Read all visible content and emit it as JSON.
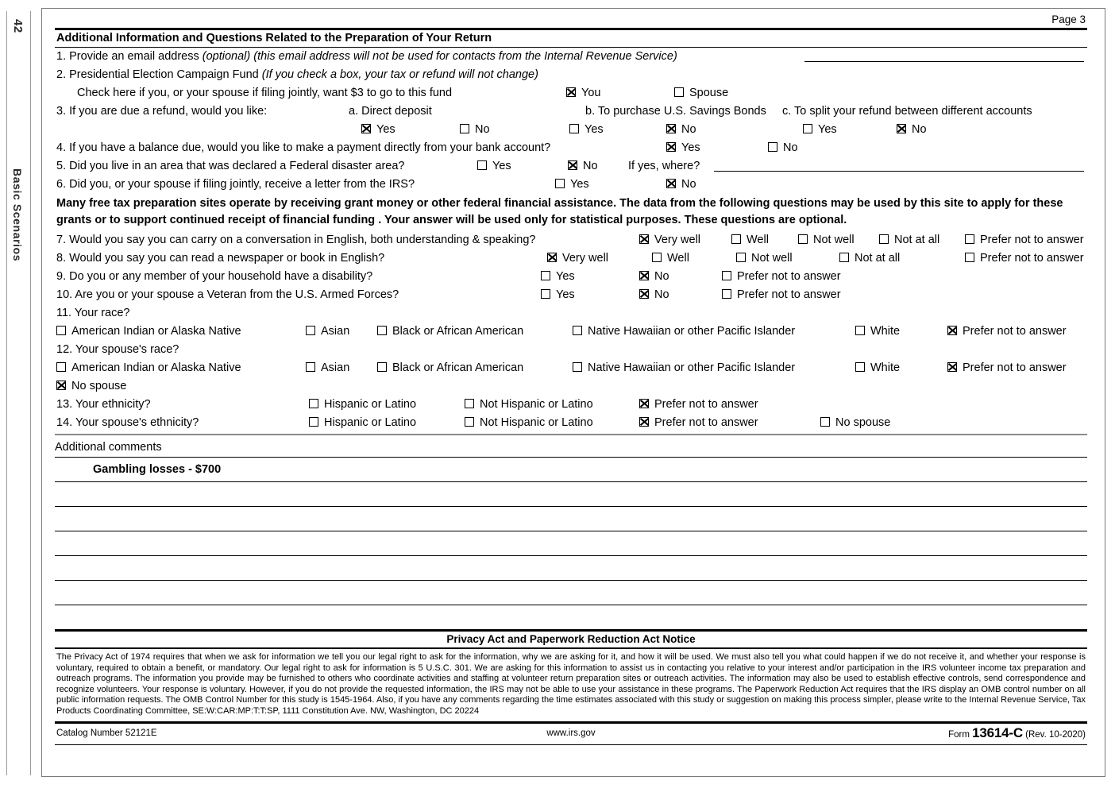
{
  "margin": {
    "page_number": "42",
    "section_label": "Basic Scenarios"
  },
  "page": {
    "page_label": "Page 3"
  },
  "section": {
    "title": "Additional Information and Questions Related to the Preparation of Your Return"
  },
  "q1": {
    "number": "1.",
    "text": "Provide an email address",
    "italic1": "(optional)",
    "italic2": "(this email address will not be used for contacts from the Internal Revenue Service)",
    "value": ""
  },
  "q2": {
    "number": "2.",
    "text": "Presidential Election Campaign Fund",
    "italic": "(If you check a box, your tax or refund will not change)",
    "subtext": "Check here if you, or your spouse if filing jointly, want $3 to go to this fund",
    "options": [
      {
        "label": "You",
        "checked": true
      },
      {
        "label": "Spouse",
        "checked": false
      }
    ]
  },
  "q3": {
    "number": "3.",
    "text": "If you are due a refund, would you like:",
    "a_label": "a. Direct deposit",
    "b_label": "b. To purchase U.S. Savings Bonds",
    "c_label": "c. To split your refund between different accounts",
    "a_options": [
      {
        "label": "Yes",
        "checked": true
      },
      {
        "label": "No",
        "checked": false
      }
    ],
    "b_options": [
      {
        "label": "Yes",
        "checked": false
      },
      {
        "label": "No",
        "checked": true
      }
    ],
    "c_options": [
      {
        "label": "Yes",
        "checked": false
      },
      {
        "label": "No",
        "checked": true
      }
    ]
  },
  "q4": {
    "number": "4.",
    "text": "If you have a balance due, would you like to make a payment directly from your bank account?",
    "options": [
      {
        "label": "Yes",
        "checked": true
      },
      {
        "label": "No",
        "checked": false
      }
    ]
  },
  "q5": {
    "number": "5.",
    "text": "Did you live in an area that was declared a Federal disaster area?",
    "options": [
      {
        "label": "Yes",
        "checked": false
      },
      {
        "label": "No",
        "checked": true
      }
    ],
    "followup": "If yes, where?",
    "followup_value": ""
  },
  "q6": {
    "number": "6.",
    "text": "Did you, or your spouse if filing jointly, receive a letter from the IRS?",
    "options": [
      {
        "label": "Yes",
        "checked": false
      },
      {
        "label": "No",
        "checked": true
      }
    ]
  },
  "statistical_notice": "Many free tax preparation sites operate by receiving grant money or other federal financial assistance. The data from the following questions may be used by this site to apply for these grants or to support continued receipt of financial funding . Your answer will be used only for statistical purposes. These questions are optional.",
  "q7": {
    "number": "7.",
    "text": "Would you say you can carry on a conversation in English, both understanding & speaking?",
    "options": [
      {
        "label": "Very well",
        "checked": true
      },
      {
        "label": "Well",
        "checked": false
      },
      {
        "label": "Not well",
        "checked": false
      },
      {
        "label": "Not at all",
        "checked": false
      },
      {
        "label": "Prefer not to answer",
        "checked": false
      }
    ]
  },
  "q8": {
    "number": "8.",
    "text": "Would you say you can read a newspaper or book in English?",
    "options": [
      {
        "label": "Very well",
        "checked": true
      },
      {
        "label": "Well",
        "checked": false
      },
      {
        "label": "Not well",
        "checked": false
      },
      {
        "label": "Not at all",
        "checked": false
      },
      {
        "label": "Prefer not to answer",
        "checked": false
      }
    ]
  },
  "q9": {
    "number": "9.",
    "text": "Do you or any member of your household have a disability?",
    "options": [
      {
        "label": "Yes",
        "checked": false
      },
      {
        "label": "No",
        "checked": true
      },
      {
        "label": "Prefer not to answer",
        "checked": false
      }
    ]
  },
  "q10": {
    "number": "10.",
    "text": "Are you or your spouse a Veteran from the U.S. Armed Forces?",
    "options": [
      {
        "label": "Yes",
        "checked": false
      },
      {
        "label": "No",
        "checked": true
      },
      {
        "label": "Prefer not to answer",
        "checked": false
      }
    ]
  },
  "q11": {
    "number": "11.",
    "text": "Your race?",
    "options": [
      {
        "label": "American Indian or Alaska Native",
        "checked": false
      },
      {
        "label": "Asian",
        "checked": false
      },
      {
        "label": "Black or African American",
        "checked": false
      },
      {
        "label": "Native Hawaiian or other Pacific Islander",
        "checked": false
      },
      {
        "label": "White",
        "checked": false
      },
      {
        "label": "Prefer not to answer",
        "checked": true
      }
    ]
  },
  "q12": {
    "number": "12.",
    "text": "Your spouse's race?",
    "options": [
      {
        "label": "American Indian or Alaska Native",
        "checked": false
      },
      {
        "label": "Asian",
        "checked": false
      },
      {
        "label": "Black or African American",
        "checked": false
      },
      {
        "label": "Native Hawaiian or other Pacific Islander",
        "checked": false
      },
      {
        "label": "White",
        "checked": false
      },
      {
        "label": "Prefer not to answer",
        "checked": true
      }
    ],
    "no_spouse": {
      "label": "No spouse",
      "checked": true
    }
  },
  "q13": {
    "number": "13.",
    "text": "Your ethnicity?",
    "options": [
      {
        "label": "Hispanic or Latino",
        "checked": false
      },
      {
        "label": "Not Hispanic or Latino",
        "checked": false
      },
      {
        "label": "Prefer not to answer",
        "checked": true
      }
    ]
  },
  "q14": {
    "number": "14.",
    "text": "Your spouse's ethnicity?",
    "options": [
      {
        "label": "Hispanic or Latino",
        "checked": false
      },
      {
        "label": "Not Hispanic or Latino",
        "checked": false
      },
      {
        "label": "Prefer not to answer",
        "checked": true
      },
      {
        "label": "No spouse",
        "checked": false
      }
    ]
  },
  "comments": {
    "heading": "Additional comments",
    "line1": "Gambling losses - $700",
    "blank_lines": 6
  },
  "privacy": {
    "title": "Privacy Act and Paperwork Reduction Act Notice",
    "body": "The Privacy Act of 1974 requires that when we ask for information we tell you our legal right to ask for the information, why we are asking for it, and how it will be used. We must also tell you what could happen if we do not receive it, and whether your response is voluntary, required to obtain a benefit, or mandatory. Our legal right to ask for information is 5 U.S.C. 301. We are asking for this information to assist us in contacting you relative to your interest and/or participation in the IRS volunteer income tax preparation and outreach programs. The information you provide may be furnished to others who coordinate activities and staffing at volunteer return preparation sites or outreach activities. The information may also be used to establish effective controls, send correspondence and recognize volunteers. Your response is voluntary. However, if you do not provide the requested information, the IRS may not be able to use your assistance in these programs. The Paperwork Reduction Act requires that the IRS display an OMB control number on all public information requests. The OMB Control Number for this study is 1545-1964. Also, if you have any comments regarding the time estimates associated with this study or suggestion on making this process simpler, please write to the Internal Revenue Service, Tax Products Coordinating Committee, SE:W:CAR:MP:T:T:SP, 1111 Constitution Ave. NW, Washington, DC 20224"
  },
  "footer": {
    "catalog": "Catalog Number 52121E",
    "website": "www.irs.gov",
    "form_prefix": "Form",
    "form_number": "13614-C",
    "form_rev": "(Rev. 10-2020)"
  }
}
